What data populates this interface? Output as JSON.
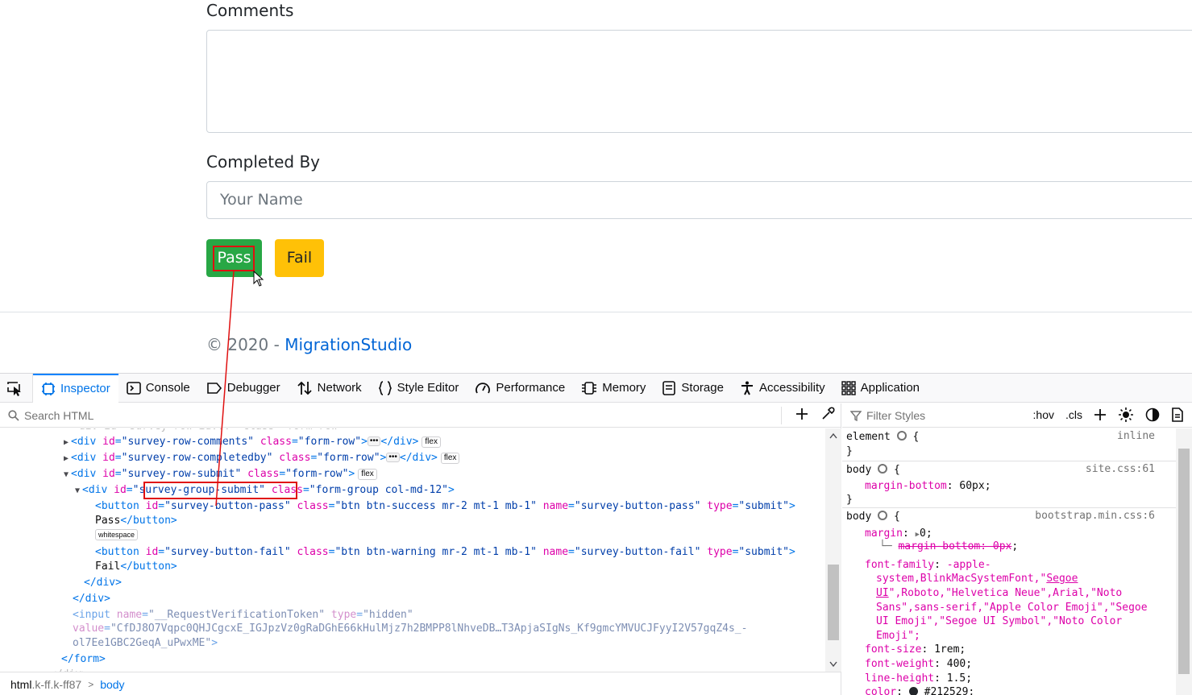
{
  "page": {
    "comments_label": "Comments",
    "completed_by_label": "Completed By",
    "name_placeholder": "Your Name",
    "pass_label": "Pass",
    "fail_label": "Fail",
    "footer_copyright": "© 2020 - ",
    "footer_link": "MigrationStudio",
    "colors": {
      "pass": "#28a745",
      "fail": "#ffc107",
      "link": "#0366d6",
      "highlight": "#e01010"
    }
  },
  "devtools": {
    "tabs": [
      "Inspector",
      "Console",
      "Debugger",
      "Network",
      "Style Editor",
      "Performance",
      "Memory",
      "Storage",
      "Accessibility",
      "Application"
    ],
    "active_tab": "Inspector",
    "search_placeholder": "Search HTML",
    "filter_placeholder": "Filter Styles",
    "hov": ":hov",
    "cls": ".cls",
    "breadcrumbs": {
      "first": "html",
      "first_suffix": ".k-ff.k-ff87",
      "second": "body"
    },
    "html_tree": {
      "row_comments": {
        "id": "\"survey-row-comments\"",
        "class": "\"form-row\"",
        "badge": "flex"
      },
      "row_completedby": {
        "id": "\"survey-row-completedby\"",
        "class": "\"form-row\"",
        "badge": "flex"
      },
      "row_submit": {
        "id": "\"survey-row-submit\"",
        "class": "\"form-row\"",
        "badge": "flex"
      },
      "group_submit": {
        "id": "\"survey-group-submit\"",
        "class": "\"form-group col-md-12\""
      },
      "btn_pass": {
        "id": "\"survey-button-pass\"",
        "class": "\"btn btn-success mr-2 mt-1 mb-1\"",
        "name": "\"survey-button-pass\"",
        "type": "\"submit\"",
        "text": "Pass"
      },
      "whitespace_badge": "whitespace",
      "btn_fail": {
        "id": "\"survey-button-fail\"",
        "class": "\"btn btn-warning mr-2 mt-1 mb-1\"",
        "name": "\"survey-button-fail\"",
        "type": "\"submit\"",
        "text": "Fail"
      },
      "token_input": {
        "name": "\"__RequestVerificationToken\"",
        "type": "\"hidden\"",
        "value_line1": "\"CfDJ8O7Vqpc0QHJCgcxE_IGJpzVz0gRaDGhE66kHulMjz7h2BMPP8lNhveDB…T3ApjaSIgNs_Kf9gmcYMVUCJFyyI2V57gqZ4s_-",
        "value_line2": "ol7Ee1GBC2GeqA_uPwxME\""
      }
    },
    "rules": {
      "element": {
        "selector": "element",
        "source": "inline"
      },
      "body_site": {
        "selector": "body",
        "source": "site.css:61",
        "prop": "margin-bottom",
        "value": "60px"
      },
      "body_bootstrap": {
        "selector": "body",
        "source": "bootstrap.min.css:6",
        "margin": "0",
        "margin_bottom_overridden": "margin-bottom: 0px",
        "font_family_l1": "-apple-",
        "font_family_l2a": "system,BlinkMacSystemFont,\"",
        "font_family_l2b": "Segoe",
        "font_family_l3a": "UI",
        "font_family_l3b": "\",Roboto,\"Helvetica Neue\",Arial,\"Noto",
        "font_family_l4": "Sans\",sans-serif,\"Apple Color Emoji\",\"Segoe",
        "font_family_l5": "UI Emoji\",\"Segoe UI Symbol\",\"Noto Color",
        "font_family_l6": "Emoji\";",
        "font_size": "1rem",
        "font_weight": "400",
        "line_height": "1.5",
        "color": "#212529"
      }
    }
  }
}
